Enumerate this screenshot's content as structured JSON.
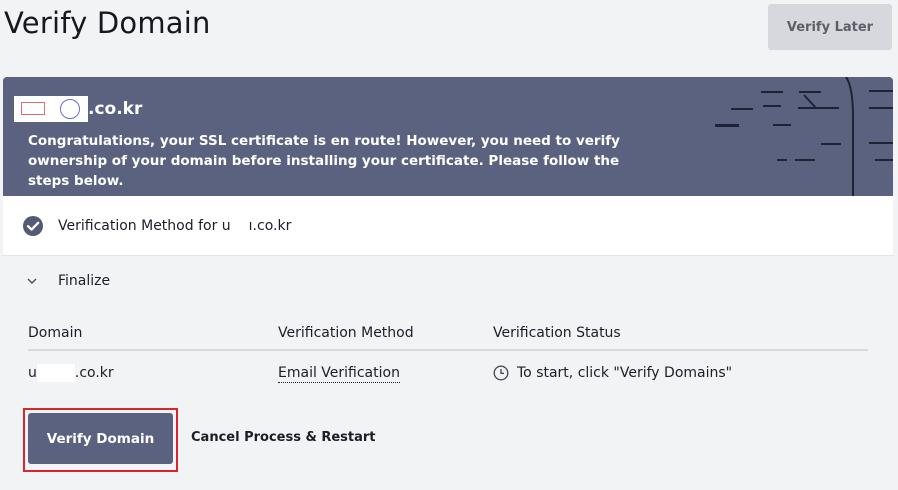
{
  "header": {
    "title": "Verify Domain",
    "verify_later_label": "Verify Later"
  },
  "banner": {
    "domain_suffix": ".co.kr",
    "message": "Congratulations, your SSL certificate is en route! However, you need to verify ownership of your domain before installing your certificate. Please follow the steps below."
  },
  "method": {
    "label_prefix": "Verification Method for u",
    "label_suffix": "ı.co.kr"
  },
  "finalize": {
    "label": "Finalize"
  },
  "table": {
    "headers": [
      "Domain",
      "Verification Method",
      "Verification Status"
    ],
    "rows": [
      {
        "domain_prefix": "u",
        "domain_suffix": ".co.kr",
        "method": "Email Verification",
        "status": "To start, click \"Verify Domains\""
      }
    ]
  },
  "actions": {
    "verify_domain_label": "Verify Domain",
    "cancel_label": "Cancel Process & Restart"
  },
  "colors": {
    "banner": "#5b6280",
    "highlight": "#d9262c",
    "background": "#f2f3f5"
  }
}
